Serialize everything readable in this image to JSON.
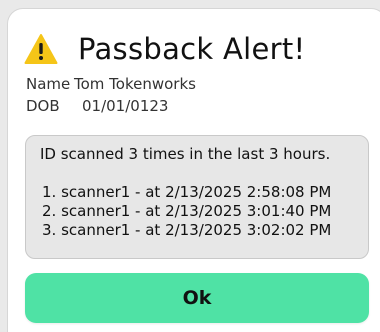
{
  "dialog": {
    "title": "Passback Alert!",
    "icon": "warning-triangle-icon",
    "colors": {
      "accent": "#4fe2a5",
      "warning": "#f5c518",
      "message_bg": "#e7e7e7"
    },
    "person": {
      "name_label": "Name",
      "name_value": "Tom Tokenworks",
      "dob_label": "DOB",
      "dob_value": "01/01/0123"
    },
    "message": "ID scanned 3 times in the last 3 hours.",
    "scans": [
      "1. scanner1 - at 2/13/2025 2:58:08 PM",
      "2. scanner1 - at 2/13/2025 3:01:40 PM",
      "3. scanner1 - at 2/13/2025 3:02:02 PM"
    ],
    "ok_label": "Ok"
  }
}
